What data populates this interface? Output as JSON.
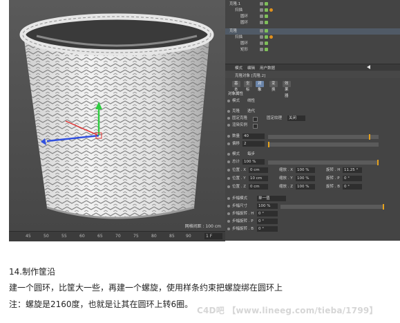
{
  "viewport": {
    "status_text": "网格间距 : 100 cm"
  },
  "timeline": {
    "ticks": [
      "45",
      "50",
      "55",
      "60",
      "65",
      "70",
      "75",
      "80",
      "85",
      "90"
    ],
    "frame_field": "1 F"
  },
  "object_manager": {
    "rows": [
      {
        "name": "克隆.1"
      },
      {
        "name": "扫描"
      },
      {
        "name": "圆环"
      },
      {
        "name": "圆环"
      },
      {
        "name": "克隆"
      },
      {
        "name": "扫描"
      },
      {
        "name": "圆环"
      },
      {
        "name": "矩形"
      }
    ]
  },
  "attributes": {
    "menu": [
      "模式",
      "编辑",
      "用户数据"
    ],
    "object_title": "克隆对象 [克隆.2]",
    "tabs": [
      "基本",
      "坐标",
      "对象",
      "变换",
      "效果器"
    ],
    "section_title": "对象属性",
    "params": {
      "mode_label": "模式",
      "mode_value": "线性",
      "clone_label": "克隆",
      "clone_value": "迭代",
      "fix_clone_label": "固定克隆",
      "fix_texture_label": "固定纹理",
      "fix_texture_value": "关闭",
      "render_instance_label": "渲染实例",
      "count_label": "数量",
      "count_value": "40",
      "offset_label": "偏移",
      "offset_value": "2",
      "mode2_label": "模式",
      "mode2_value": "每步",
      "total_label": "总计",
      "total_value": "100 %",
      "pos_x_label": "位置 . X",
      "pos_x_value": "0 cm",
      "pos_y_label": "位置 . Y",
      "pos_y_value": "10 cm",
      "pos_z_label": "位置 . Z",
      "pos_z_value": "0 cm",
      "scale_x_label": "缩放 . X",
      "scale_x_value": "100 %",
      "scale_y_label": "缩放 . Y",
      "scale_y_value": "100 %",
      "scale_z_label": "缩放 . Z",
      "scale_z_value": "100 %",
      "rot_h_label": "旋转 . H",
      "rot_h_value": "11.25 °",
      "rot_p_label": "旋转 . P",
      "rot_p_value": "0 °",
      "rot_b_label": "旋转 . B",
      "rot_b_value": "0 °",
      "step_mode_label": "步幅模式",
      "step_mode_value": "单一值",
      "step_size_label": "步幅尺寸",
      "step_size_value": "100 %",
      "step_rot_h_label": "步幅旋转 . H",
      "step_rot_h_value": "0 °",
      "step_rot_p_label": "步幅旋转 . P",
      "step_rot_p_value": "0 °",
      "step_rot_b_label": "步幅旋转 . B",
      "step_rot_b_value": "0 °"
    }
  },
  "caption": {
    "line1": "14.制作筐沿",
    "line2": "建一个圆环，比筐大一些，再建一个螺旋，使用样条约束把螺旋绑在圆环上",
    "line3": "注：螺旋是2160度，也就是让其在圆环上转6圈。"
  },
  "watermark": {
    "logo": "C4D吧",
    "text": "【www.lineeg.com/tieba/1799】"
  },
  "colors": {
    "viewport_bg": "#4f4f4f",
    "panel_bg": "#444444",
    "active_tab": "#6a84a8",
    "check_green": "#7fbf5a",
    "tag_orange": "#e0901e",
    "axis_y": "#2ecc40",
    "axis_x": "#e03030",
    "axis_z": "#3050e0"
  }
}
